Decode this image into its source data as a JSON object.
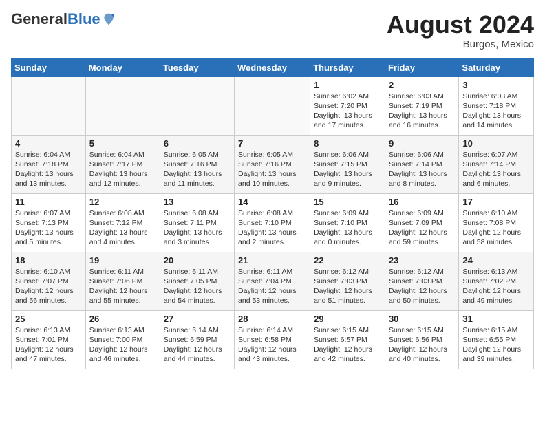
{
  "header": {
    "logo_general": "General",
    "logo_blue": "Blue",
    "month_title": "August 2024",
    "location": "Burgos, Mexico"
  },
  "days_of_week": [
    "Sunday",
    "Monday",
    "Tuesday",
    "Wednesday",
    "Thursday",
    "Friday",
    "Saturday"
  ],
  "weeks": [
    [
      {
        "day": "",
        "content": ""
      },
      {
        "day": "",
        "content": ""
      },
      {
        "day": "",
        "content": ""
      },
      {
        "day": "",
        "content": ""
      },
      {
        "day": "1",
        "content": "Sunrise: 6:02 AM\nSunset: 7:20 PM\nDaylight: 13 hours and 17 minutes."
      },
      {
        "day": "2",
        "content": "Sunrise: 6:03 AM\nSunset: 7:19 PM\nDaylight: 13 hours and 16 minutes."
      },
      {
        "day": "3",
        "content": "Sunrise: 6:03 AM\nSunset: 7:18 PM\nDaylight: 13 hours and 14 minutes."
      }
    ],
    [
      {
        "day": "4",
        "content": "Sunrise: 6:04 AM\nSunset: 7:18 PM\nDaylight: 13 hours and 13 minutes."
      },
      {
        "day": "5",
        "content": "Sunrise: 6:04 AM\nSunset: 7:17 PM\nDaylight: 13 hours and 12 minutes."
      },
      {
        "day": "6",
        "content": "Sunrise: 6:05 AM\nSunset: 7:16 PM\nDaylight: 13 hours and 11 minutes."
      },
      {
        "day": "7",
        "content": "Sunrise: 6:05 AM\nSunset: 7:16 PM\nDaylight: 13 hours and 10 minutes."
      },
      {
        "day": "8",
        "content": "Sunrise: 6:06 AM\nSunset: 7:15 PM\nDaylight: 13 hours and 9 minutes."
      },
      {
        "day": "9",
        "content": "Sunrise: 6:06 AM\nSunset: 7:14 PM\nDaylight: 13 hours and 8 minutes."
      },
      {
        "day": "10",
        "content": "Sunrise: 6:07 AM\nSunset: 7:14 PM\nDaylight: 13 hours and 6 minutes."
      }
    ],
    [
      {
        "day": "11",
        "content": "Sunrise: 6:07 AM\nSunset: 7:13 PM\nDaylight: 13 hours and 5 minutes."
      },
      {
        "day": "12",
        "content": "Sunrise: 6:08 AM\nSunset: 7:12 PM\nDaylight: 13 hours and 4 minutes."
      },
      {
        "day": "13",
        "content": "Sunrise: 6:08 AM\nSunset: 7:11 PM\nDaylight: 13 hours and 3 minutes."
      },
      {
        "day": "14",
        "content": "Sunrise: 6:08 AM\nSunset: 7:10 PM\nDaylight: 13 hours and 2 minutes."
      },
      {
        "day": "15",
        "content": "Sunrise: 6:09 AM\nSunset: 7:10 PM\nDaylight: 13 hours and 0 minutes."
      },
      {
        "day": "16",
        "content": "Sunrise: 6:09 AM\nSunset: 7:09 PM\nDaylight: 12 hours and 59 minutes."
      },
      {
        "day": "17",
        "content": "Sunrise: 6:10 AM\nSunset: 7:08 PM\nDaylight: 12 hours and 58 minutes."
      }
    ],
    [
      {
        "day": "18",
        "content": "Sunrise: 6:10 AM\nSunset: 7:07 PM\nDaylight: 12 hours and 56 minutes."
      },
      {
        "day": "19",
        "content": "Sunrise: 6:11 AM\nSunset: 7:06 PM\nDaylight: 12 hours and 55 minutes."
      },
      {
        "day": "20",
        "content": "Sunrise: 6:11 AM\nSunset: 7:05 PM\nDaylight: 12 hours and 54 minutes."
      },
      {
        "day": "21",
        "content": "Sunrise: 6:11 AM\nSunset: 7:04 PM\nDaylight: 12 hours and 53 minutes."
      },
      {
        "day": "22",
        "content": "Sunrise: 6:12 AM\nSunset: 7:03 PM\nDaylight: 12 hours and 51 minutes."
      },
      {
        "day": "23",
        "content": "Sunrise: 6:12 AM\nSunset: 7:03 PM\nDaylight: 12 hours and 50 minutes."
      },
      {
        "day": "24",
        "content": "Sunrise: 6:13 AM\nSunset: 7:02 PM\nDaylight: 12 hours and 49 minutes."
      }
    ],
    [
      {
        "day": "25",
        "content": "Sunrise: 6:13 AM\nSunset: 7:01 PM\nDaylight: 12 hours and 47 minutes."
      },
      {
        "day": "26",
        "content": "Sunrise: 6:13 AM\nSunset: 7:00 PM\nDaylight: 12 hours and 46 minutes."
      },
      {
        "day": "27",
        "content": "Sunrise: 6:14 AM\nSunset: 6:59 PM\nDaylight: 12 hours and 44 minutes."
      },
      {
        "day": "28",
        "content": "Sunrise: 6:14 AM\nSunset: 6:58 PM\nDaylight: 12 hours and 43 minutes."
      },
      {
        "day": "29",
        "content": "Sunrise: 6:15 AM\nSunset: 6:57 PM\nDaylight: 12 hours and 42 minutes."
      },
      {
        "day": "30",
        "content": "Sunrise: 6:15 AM\nSunset: 6:56 PM\nDaylight: 12 hours and 40 minutes."
      },
      {
        "day": "31",
        "content": "Sunrise: 6:15 AM\nSunset: 6:55 PM\nDaylight: 12 hours and 39 minutes."
      }
    ]
  ]
}
